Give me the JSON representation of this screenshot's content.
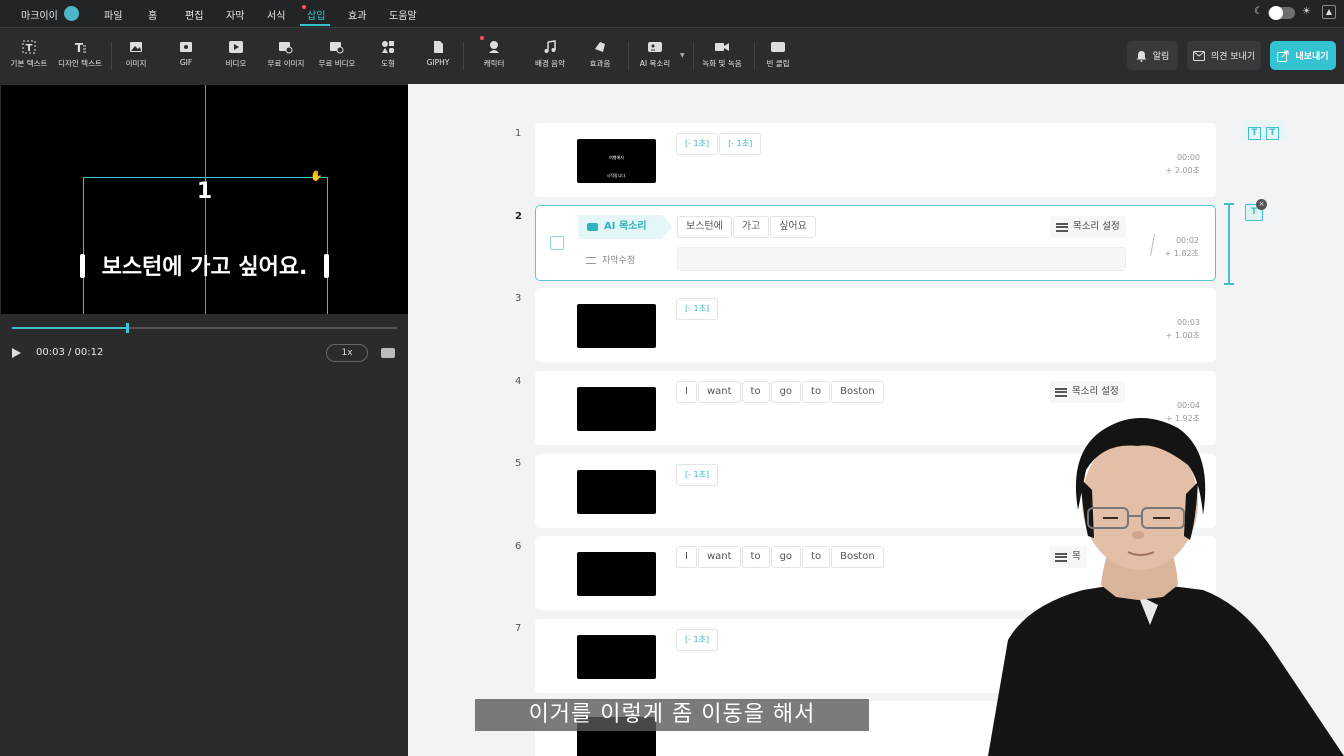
{
  "topbar": {
    "brand": "마크이이",
    "menu": [
      "파일",
      "홈",
      "편집",
      "자막",
      "서식",
      "삽입",
      "효과",
      "도움말"
    ],
    "active_menu": "삽입"
  },
  "toolbar": {
    "tools": [
      {
        "label": "기본 텍스트",
        "icon": "text-icon"
      },
      {
        "label": "디자인 텍스트",
        "icon": "design-text-icon"
      },
      {
        "label": "이미지",
        "icon": "image-icon"
      },
      {
        "label": "GIF",
        "icon": "gif-icon"
      },
      {
        "label": "비디오",
        "icon": "video-icon"
      },
      {
        "label": "무료 이미지",
        "icon": "free-image-icon"
      },
      {
        "label": "무료 비디오",
        "icon": "free-video-icon"
      },
      {
        "label": "도형",
        "icon": "shape-icon"
      },
      {
        "label": "GIPHY",
        "icon": "giphy-icon"
      },
      {
        "label": "캐릭터",
        "icon": "character-icon"
      },
      {
        "label": "배경 음악",
        "icon": "music-icon"
      },
      {
        "label": "효과음",
        "icon": "sound-effect-icon"
      },
      {
        "label": "AI 목소리",
        "icon": "ai-voice-icon"
      },
      {
        "label": "녹화 및 녹음",
        "icon": "record-icon"
      },
      {
        "label": "빈 클립",
        "icon": "blank-clip-icon"
      }
    ],
    "notify_label": "알림",
    "feedback_label": "의견 보내기",
    "export_label": "내보내기"
  },
  "preview": {
    "clip_number": "1",
    "caption": "보스턴에 가고 싶어요.",
    "timecode": "00:03 / 00:12",
    "speed": "1x",
    "progress": 0.3
  },
  "timeline": {
    "rows": [
      {
        "num": "1",
        "thumb_lines": [
          "여행해서",
          "시작합니다."
        ],
        "chips": [
          "[- 1초]",
          "[- 1초]"
        ],
        "time": "00:00",
        "dur": "+ 2.00초"
      },
      {
        "num": "2",
        "ai_voice": "AI 목소리",
        "chips": [
          "보스턴에",
          "가고",
          "싶어요"
        ],
        "voice_setting": "목소리 설정",
        "edit_label": "자막수정",
        "time": "00:02",
        "dur": "+ 1.82초"
      },
      {
        "num": "3",
        "chips": [
          "[- 1초]"
        ],
        "time": "00:03",
        "dur": "+ 1.00초"
      },
      {
        "num": "4",
        "chips": [
          "I",
          "want",
          "to",
          "go",
          "to",
          "Boston"
        ],
        "voice_setting": "목소리 설정",
        "time": "00:04",
        "dur": "+ 1.92초"
      },
      {
        "num": "5",
        "chips": [
          "[- 1초]"
        ]
      },
      {
        "num": "6",
        "chips": [
          "I",
          "want",
          "to",
          "go",
          "to",
          "Boston"
        ],
        "voice_setting": "목"
      },
      {
        "num": "7",
        "chips": [
          "[- 1초]"
        ]
      }
    ]
  },
  "overlay_subtitle": "이거를 이렇게 좀 이동을 해서"
}
